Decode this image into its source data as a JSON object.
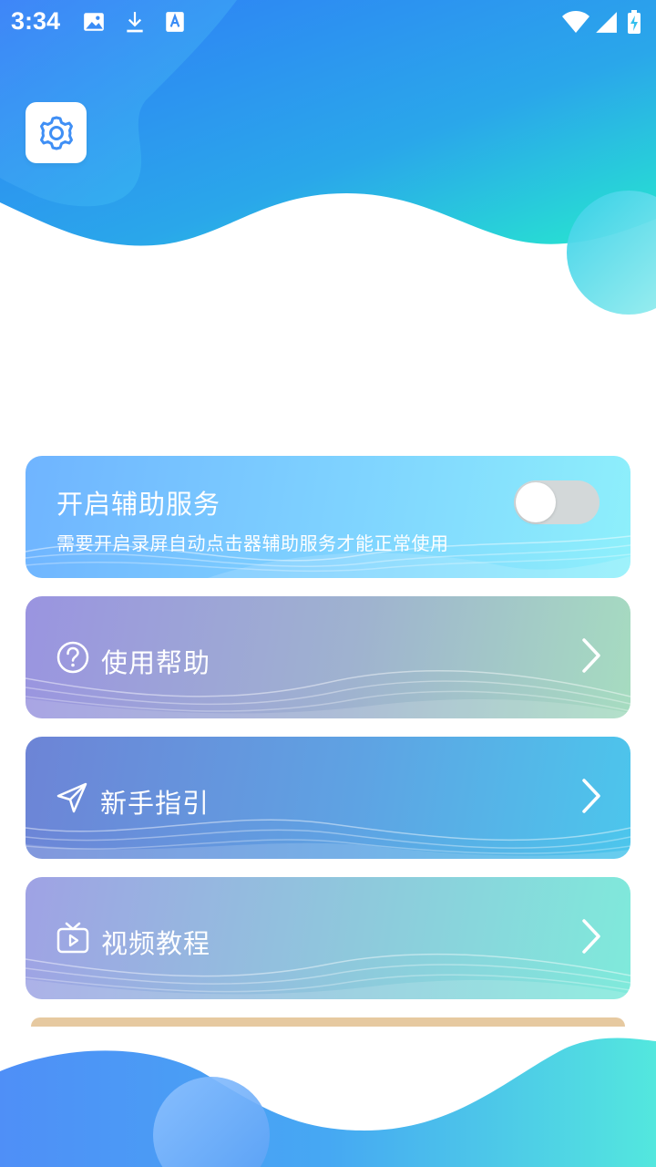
{
  "status_bar": {
    "time": "3:34",
    "icons": [
      "image-icon",
      "download-icon",
      "translate-icon",
      "wifi-icon",
      "signal-icon",
      "battery-icon"
    ]
  },
  "settings": {
    "icon": "gear-icon"
  },
  "accessibility_card": {
    "title": "开启辅助服务",
    "subtitle": "需要开启录屏自动点击器辅助服务才能正常使用",
    "toggle_on": false
  },
  "menu": {
    "help_label": "使用帮助",
    "help_icon": "question-circle-icon",
    "guide_label": "新手指引",
    "guide_icon": "navigation-arrow-icon",
    "video_label": "视频教程",
    "video_icon": "tv-play-icon"
  },
  "colors": {
    "accent_blue": "#3f8ff5",
    "accent_cyan": "#2ee6d2",
    "toggle_track": "#d7d7d7"
  }
}
